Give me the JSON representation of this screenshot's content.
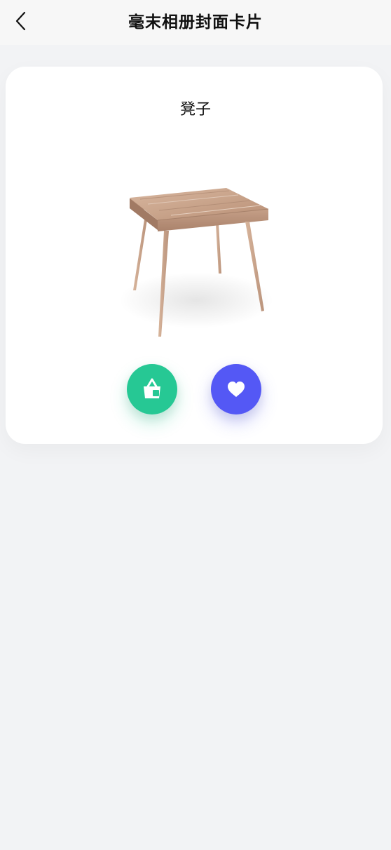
{
  "nav": {
    "title": "毫末相册封面卡片",
    "back_icon": "chevron-left-icon"
  },
  "card": {
    "title": "凳子",
    "image": "wooden-stool-image"
  },
  "actions": {
    "cart": {
      "icon": "shopping-basket-icon",
      "color": "#26c894"
    },
    "favorite": {
      "icon": "heart-icon",
      "color": "#5458f5"
    }
  },
  "colors": {
    "background": "#f2f3f5",
    "nav_background": "#f7f7f7",
    "card_background": "#ffffff"
  }
}
